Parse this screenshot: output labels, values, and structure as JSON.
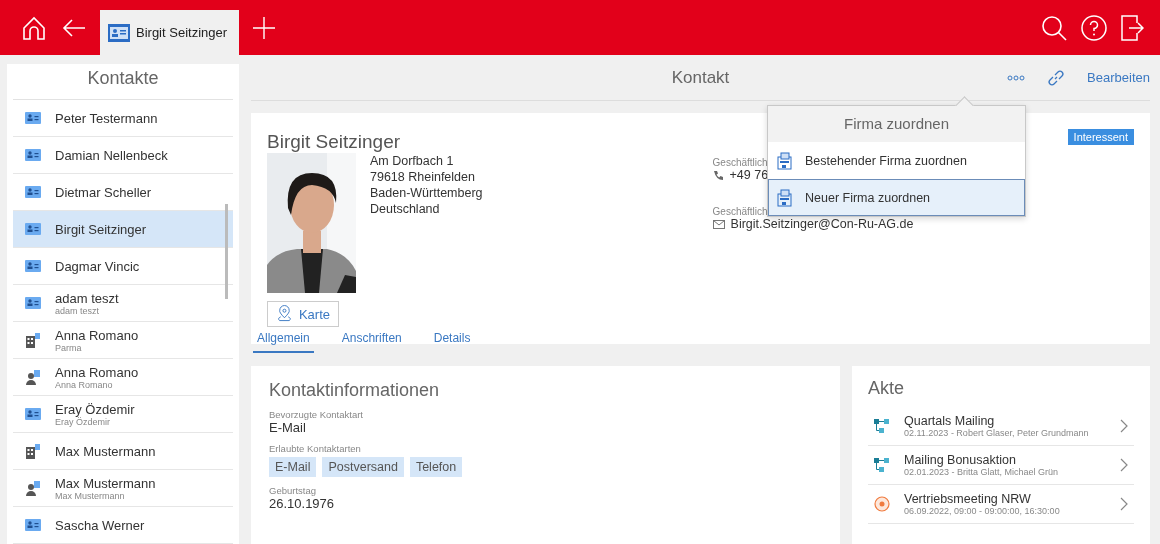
{
  "topbar": {
    "tab": {
      "label": "Birgit Seitzinger",
      "selected": true
    }
  },
  "sidebar": {
    "title": "Kontakte",
    "items": [
      {
        "kind": "contact",
        "name": "Peter Testermann",
        "selected": false
      },
      {
        "kind": "contact",
        "name": "Damian Nellenbeck",
        "selected": false
      },
      {
        "kind": "contact",
        "name": "Dietmar Scheller",
        "selected": false
      },
      {
        "kind": "contact",
        "name": "Birgit Seitzinger",
        "selected": true
      },
      {
        "kind": "contact",
        "name": "Dagmar Vincic",
        "selected": false
      },
      {
        "kind": "contact",
        "name": "adam teszt",
        "sub": "adam teszt",
        "selected": false
      },
      {
        "kind": "company",
        "name": "Anna Romano",
        "sub": "Parma",
        "selected": false
      },
      {
        "kind": "person",
        "name": "Anna Romano",
        "sub": "Anna Romano",
        "selected": false
      },
      {
        "kind": "contact",
        "name": "Eray Özdemir",
        "sub": "Eray Özdemir",
        "selected": false
      },
      {
        "kind": "company",
        "name": "Max Mustermann",
        "selected": false
      },
      {
        "kind": "person",
        "name": "Max Mustermann",
        "sub": "Max Mustermann",
        "selected": false
      },
      {
        "kind": "contact",
        "name": "Sascha Werner",
        "selected": false
      }
    ]
  },
  "header": {
    "title": "Kontakt",
    "edit": "Bearbeiten"
  },
  "contact": {
    "name": "Birgit Seitzinger",
    "badge": "Interessent",
    "address": [
      "Am Dorfbach 1",
      "79618 Rheinfelden",
      "Baden-Württemberg",
      "Deutschland"
    ],
    "map_button": "Karte",
    "channels": [
      {
        "kind": "phone",
        "label": "Geschäftlich",
        "value": "+49 76"
      },
      {
        "kind": "mail",
        "label": "Geschäftlich",
        "value": "Birgit.Seitzinger@Con-Ru-AG.de"
      }
    ],
    "tabs": [
      {
        "label": "Allgemein",
        "selected": true
      },
      {
        "label": "Anschriften",
        "selected": false
      },
      {
        "label": "Details",
        "selected": false
      }
    ]
  },
  "menu": {
    "title": "Firma zuordnen",
    "items": [
      {
        "label": "Bestehender Firma zuordnen",
        "selected": false
      },
      {
        "label": "Neuer Firma zuordnen",
        "selected": true
      }
    ]
  },
  "info": {
    "title": "Kontaktinformationen",
    "preferred_label": "Bevorzugte Kontaktart",
    "preferred": "E-Mail",
    "allowed_label": "Erlaubte Kontaktarten",
    "allowed": [
      "E-Mail",
      "Postversand",
      "Telefon"
    ],
    "birthday_label": "Geburtstag",
    "birthday": "26.10.1976"
  },
  "akte": {
    "title": "Akte",
    "items": [
      {
        "kind": "process",
        "title": "Quartals Mailing",
        "sub": "02.11.2023 - Robert Glaser, Peter Grundmann"
      },
      {
        "kind": "process",
        "title": "Mailing Bonusaktion",
        "sub": "02.01.2023 - Britta Glatt, Michael Grün"
      },
      {
        "kind": "appointment",
        "title": "Vertriebsmeeting NRW",
        "sub": "06.09.2022, 09:00 - 09:00:00, 16:30:00"
      }
    ]
  }
}
